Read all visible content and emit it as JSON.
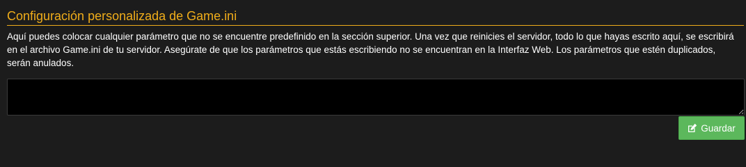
{
  "section": {
    "title": "Configuración personalizada de Game.ini",
    "description": "Aquí puedes colocar cualquier parámetro que no se encuentre predefinido en la sección superior. Una vez que reinicies el servidor, todo lo que hayas escrito aquí, se escribirá en el archivo Game.ini de tu servidor. Asegúrate de que los parámetros que estás escribiendo no se encuentran en la Interfaz Web. Los parámetros que estén duplicados, serán anulados."
  },
  "editor": {
    "value": ""
  },
  "save_button": {
    "label": "Guardar",
    "icon": "edit-icon"
  },
  "colors": {
    "accent": "#f0ad1a",
    "background": "#1c1c1c",
    "editor_background": "#000000",
    "button": "#5cb85c"
  }
}
